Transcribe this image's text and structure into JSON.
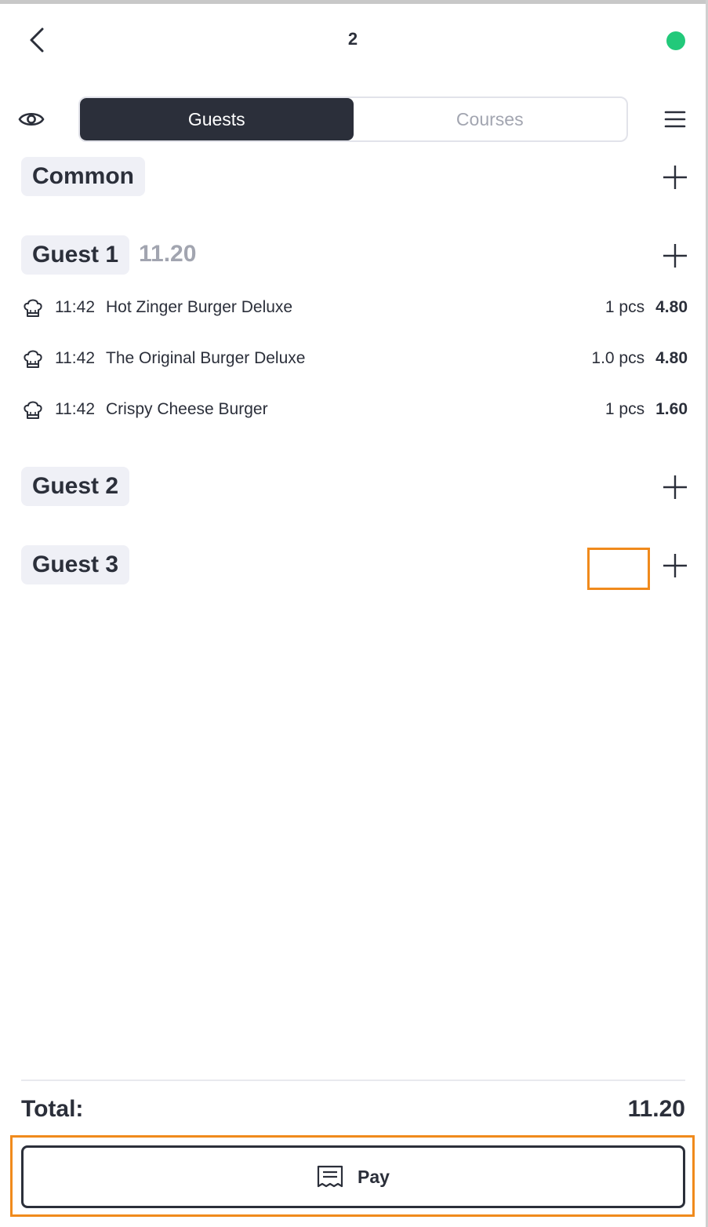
{
  "header": {
    "table_number": "2",
    "status_color": "#22c97a"
  },
  "tabs": [
    {
      "label": "Guests",
      "active": true
    },
    {
      "label": "Courses",
      "active": false
    }
  ],
  "sections": {
    "common": {
      "label": "Common"
    },
    "guest1": {
      "label": "Guest 1",
      "sum": "11.20",
      "items": [
        {
          "time": "11:42",
          "name": "Hot Zinger Burger Deluxe",
          "qty": "1 pcs",
          "price": "4.80"
        },
        {
          "time": "11:42",
          "name": "The Original Burger Deluxe",
          "qty": "1.0 pcs",
          "price": "4.80"
        },
        {
          "time": "11:42",
          "name": "Crispy Cheese Burger",
          "qty": "1 pcs",
          "price": "1.60"
        }
      ]
    },
    "guest2": {
      "label": "Guest 2"
    },
    "guest3": {
      "label": "Guest 3"
    }
  },
  "footer": {
    "total_label": "Total:",
    "total_value": "11.20",
    "pay_label": "Pay"
  },
  "icons": {
    "back": "chevron-left-icon",
    "eye": "eye-icon",
    "menu": "hamburger-menu-icon",
    "add": "plus-icon",
    "item": "chef-hat-icon",
    "pay": "receipt-icon"
  },
  "colors": {
    "dark": "#2b2f3a",
    "muted": "#a2a5b0",
    "chip_bg": "#eff0f6",
    "highlight": "#f08a1c"
  }
}
